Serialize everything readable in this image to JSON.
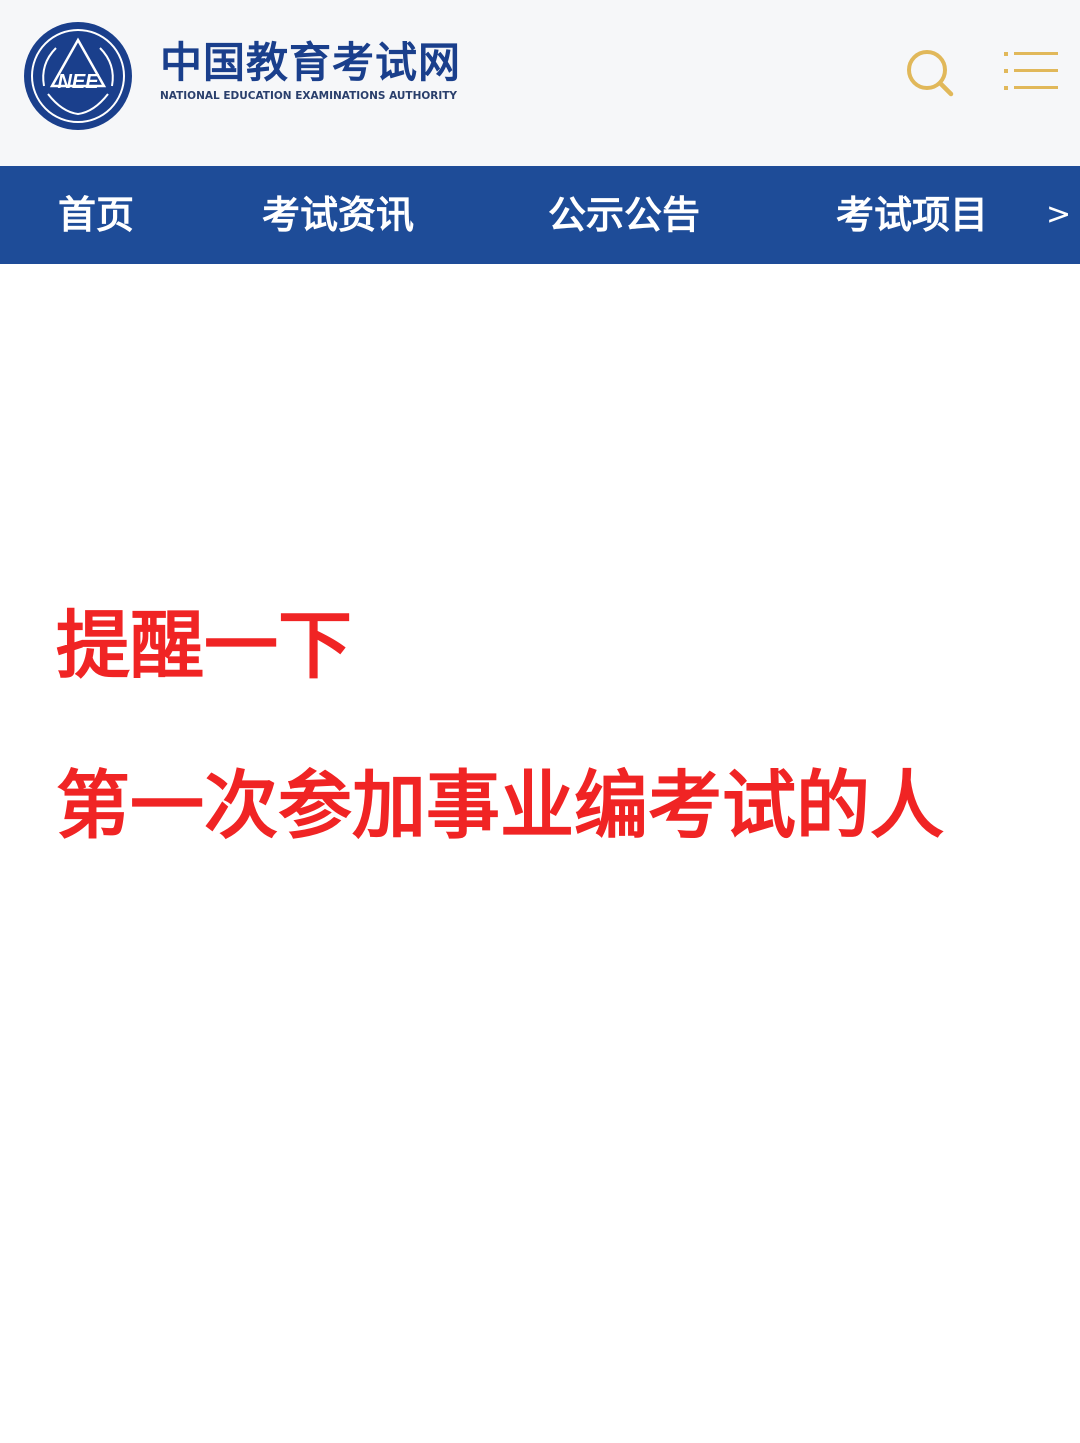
{
  "header": {
    "logo_emblem_text": "NEE",
    "site_name": "中国教育考试网",
    "site_name_en": "NATIONAL EDUCATION EXAMINATIONS AUTHORITY",
    "search_icon": "search-icon",
    "menu_icon": "hamburger-menu-icon",
    "icon_color": "#e1b85a",
    "brand_color": "#1a3f8c"
  },
  "nav": {
    "background": "#1e4c98",
    "items": [
      {
        "label": "首页"
      },
      {
        "label": "考试资讯"
      },
      {
        "label": "公示公告"
      },
      {
        "label": "考试项目"
      }
    ],
    "more_label": ">"
  },
  "main": {
    "headline_color": "#f02424",
    "lines": [
      "提醒一下",
      "第一次参加事业编考试的人"
    ]
  }
}
